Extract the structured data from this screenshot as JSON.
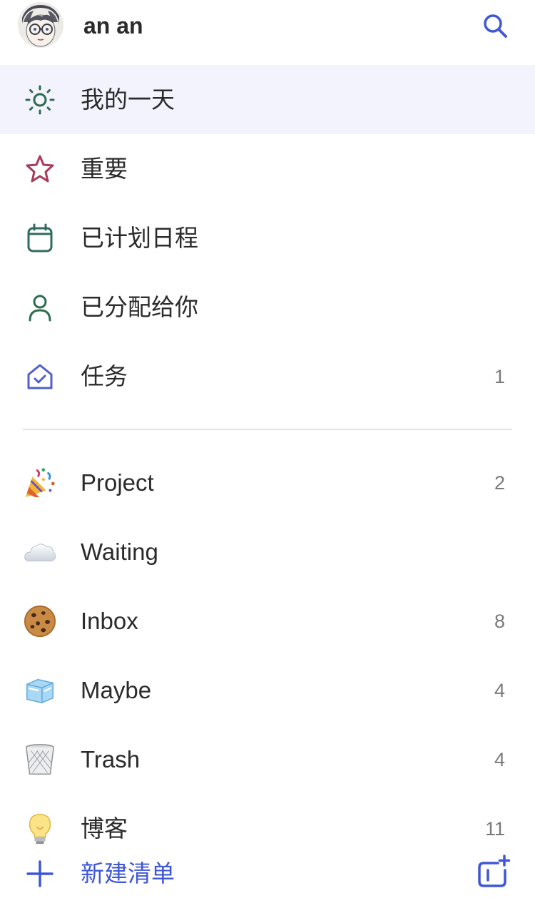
{
  "header": {
    "username": "an an",
    "avatar_icon": "avatar-sketch-portrait",
    "search_icon": "search-icon"
  },
  "smart_lists": [
    {
      "label": "我的一天",
      "icon": "sun-icon",
      "count": "",
      "selected": true
    },
    {
      "label": "重要",
      "icon": "star-icon",
      "count": ""
    },
    {
      "label": "已计划日程",
      "icon": "calendar-icon",
      "count": ""
    },
    {
      "label": "已分配给你",
      "icon": "person-icon",
      "count": ""
    },
    {
      "label": "任务",
      "icon": "home-check-icon",
      "count": "1"
    }
  ],
  "lists": [
    {
      "label": "Project",
      "icon": "party-popper-emoji",
      "count": "2"
    },
    {
      "label": "Waiting",
      "icon": "cloud-emoji",
      "count": ""
    },
    {
      "label": "Inbox",
      "icon": "cookie-emoji",
      "count": "8"
    },
    {
      "label": "Maybe",
      "icon": "ice-cube-emoji",
      "count": "4"
    },
    {
      "label": "Trash",
      "icon": "wastebasket-emoji",
      "count": "4"
    },
    {
      "label": "博客",
      "icon": "light-bulb-emoji",
      "count": "11"
    }
  ],
  "footer": {
    "new_list_label": "新建清单",
    "new_list_icon": "plus-icon",
    "new_group_icon": "new-group-icon"
  },
  "colors": {
    "accent_blue": "#3f57d6",
    "sun_green": "#2f6b4f",
    "star_red": "#a83a5c",
    "calendar_teal": "#2f6b5e",
    "task_indigo": "#5060c8",
    "selected_bg": "#f2f3fd"
  }
}
